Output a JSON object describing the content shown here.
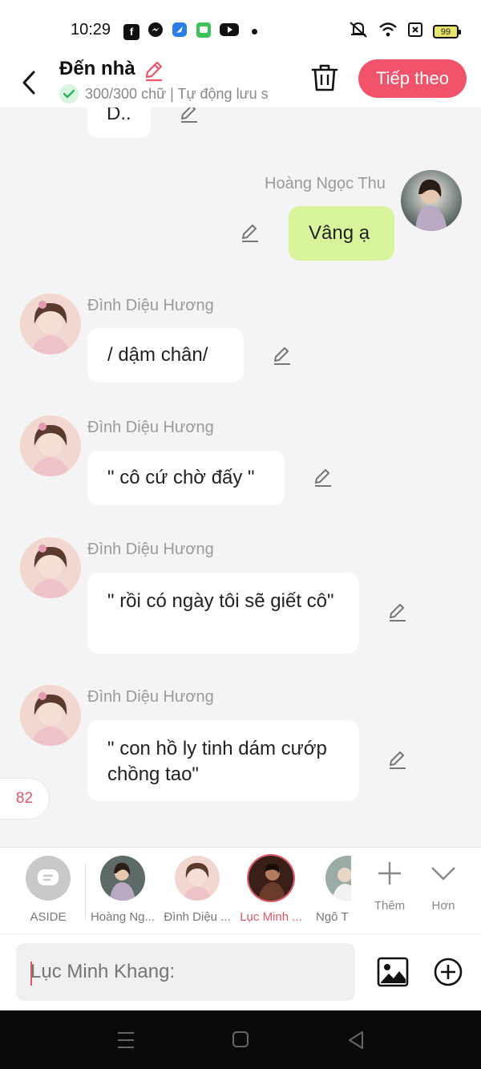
{
  "status_bar": {
    "time": "10:29",
    "battery": "99",
    "app_icons": [
      "facebook-icon",
      "messenger-icon",
      "messenger-lite-icon",
      "zalo-icon",
      "youtube-icon"
    ]
  },
  "header": {
    "title": "Đến nhà",
    "subtitle": "300/300 chữ | Tự động lưu s",
    "next_label": "Tiếp theo"
  },
  "messages": [
    {
      "sender": "",
      "text": "D..",
      "side": "left"
    },
    {
      "sender": "Hoàng Ngọc Thu",
      "text": "Vâng ạ",
      "side": "right"
    },
    {
      "sender": "Đình Diệu Hương",
      "text": "/ dậm chân/",
      "side": "left"
    },
    {
      "sender": "Đình Diệu Hương",
      "text": "\" cô cứ chờ đấy \"",
      "side": "left"
    },
    {
      "sender": "Đình Diệu Hương",
      "text": "\" rồi có ngày tôi sẽ giết cô\"",
      "side": "left"
    },
    {
      "sender": "Đình Diệu Hương",
      "text": "\" con hồ ly tinh dám cướp chồng tao\"",
      "side": "left"
    }
  ],
  "counter": "82",
  "characters": [
    {
      "label": "ASIDE"
    },
    {
      "label": "Hoàng Ng..."
    },
    {
      "label": "Đình Diệu ..."
    },
    {
      "label": "Lục Minh ..."
    },
    {
      "label": "Ngô T"
    }
  ],
  "tools": {
    "add_label": "Thêm",
    "more_label": "Hơn"
  },
  "input": {
    "placeholder": "Lục Minh Khang:"
  },
  "colors": {
    "accent": "#f2536b",
    "my_bubble": "#d9f59c",
    "background": "#f4f4f4"
  }
}
